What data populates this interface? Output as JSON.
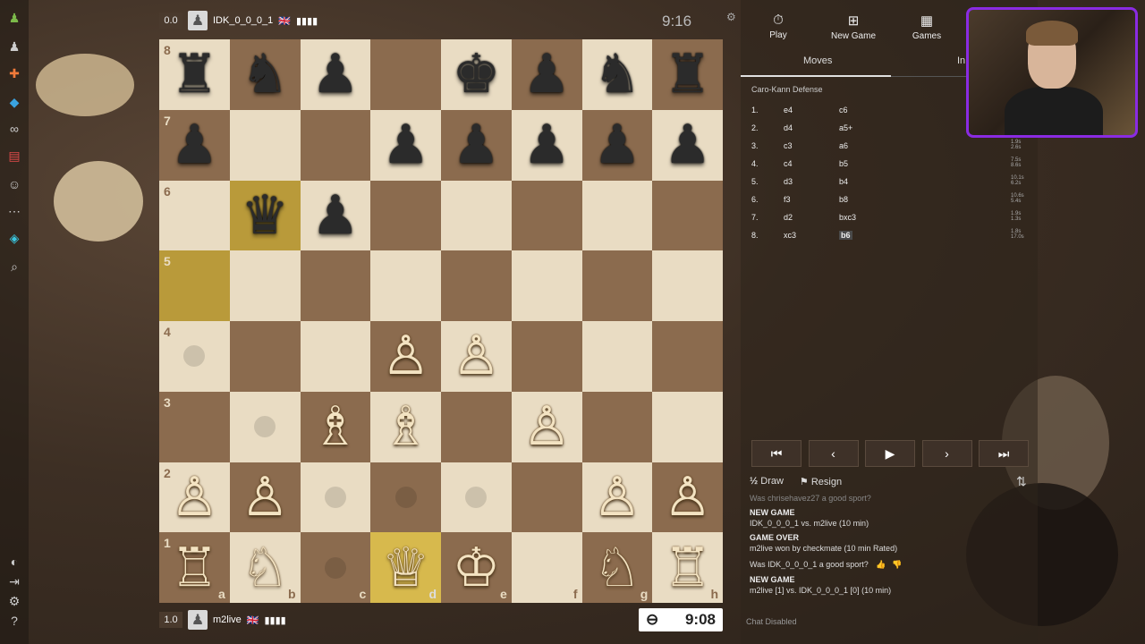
{
  "top_player": {
    "score": "0.0",
    "name": "IDK_0_0_0_1",
    "flag": "🇬🇧",
    "bars": "▮▮▮▮",
    "clock": "9:16"
  },
  "bottom_player": {
    "score": "1.0",
    "name": "m2live",
    "flag": "🇬🇧",
    "bars": "▮▮▮▮",
    "clock": "9:08",
    "clock_icon": "⊖"
  },
  "board": {
    "files": [
      "a",
      "b",
      "c",
      "d",
      "e",
      "f",
      "g",
      "h"
    ],
    "ranks": [
      "8",
      "7",
      "6",
      "5",
      "4",
      "3",
      "2",
      "1"
    ],
    "pieces": [
      {
        "sq": "a8",
        "glyph": "♜",
        "color": "b"
      },
      {
        "sq": "b8",
        "glyph": "♞",
        "color": "b"
      },
      {
        "sq": "c8",
        "glyph": "♟",
        "color": "b"
      },
      {
        "sq": "e8",
        "glyph": "♚",
        "color": "b"
      },
      {
        "sq": "f8",
        "glyph": "♟",
        "color": "b"
      },
      {
        "sq": "g8",
        "glyph": "♞",
        "color": "b"
      },
      {
        "sq": "h8",
        "glyph": "♜",
        "color": "b"
      },
      {
        "sq": "a7",
        "glyph": "♟",
        "color": "b"
      },
      {
        "sq": "d7",
        "glyph": "♟",
        "color": "b"
      },
      {
        "sq": "e7",
        "glyph": "♟",
        "color": "b"
      },
      {
        "sq": "f7",
        "glyph": "♟",
        "color": "b"
      },
      {
        "sq": "g7",
        "glyph": "♟",
        "color": "b"
      },
      {
        "sq": "h7",
        "glyph": "♟",
        "color": "b"
      },
      {
        "sq": "b6",
        "glyph": "♛",
        "color": "b"
      },
      {
        "sq": "c6",
        "glyph": "♟",
        "color": "b"
      },
      {
        "sq": "d4",
        "glyph": "♙",
        "color": "w"
      },
      {
        "sq": "e4",
        "glyph": "♙",
        "color": "w"
      },
      {
        "sq": "c3",
        "glyph": "♗",
        "color": "w"
      },
      {
        "sq": "d3",
        "glyph": "♗",
        "color": "w"
      },
      {
        "sq": "f3",
        "glyph": "♙",
        "color": "w"
      },
      {
        "sq": "a2",
        "glyph": "♙",
        "color": "w"
      },
      {
        "sq": "b2",
        "glyph": "♙",
        "color": "w"
      },
      {
        "sq": "g2",
        "glyph": "♙",
        "color": "w"
      },
      {
        "sq": "h2",
        "glyph": "♙",
        "color": "w"
      },
      {
        "sq": "a1",
        "glyph": "♖",
        "color": "w"
      },
      {
        "sq": "b1",
        "glyph": "♘",
        "color": "w"
      },
      {
        "sq": "d1",
        "glyph": "♕",
        "color": "w"
      },
      {
        "sq": "e1",
        "glyph": "♔",
        "color": "w"
      },
      {
        "sq": "g1",
        "glyph": "♘",
        "color": "w"
      },
      {
        "sq": "h1",
        "glyph": "♖",
        "color": "w"
      }
    ],
    "highlights": [
      "b6",
      "a5",
      "d1"
    ],
    "move_dots": [
      "a4",
      "b3",
      "c2",
      "d2",
      "e2",
      "c1"
    ]
  },
  "nav": {
    "play": "Play",
    "new_game": "New Game",
    "games": "Games",
    "play_icon": "⏱",
    "new_game_icon": "⊞",
    "games_icon": "▦"
  },
  "tabs": {
    "moves": "Moves",
    "info": "In"
  },
  "opening": "Caro-Kann Defense",
  "moves": [
    {
      "n": "1.",
      "w": "e4",
      "b": "c6",
      "t1": "",
      "t2": ""
    },
    {
      "n": "2.",
      "w": "d4",
      "b": "a5+",
      "t1": "",
      "t2": ""
    },
    {
      "n": "3.",
      "w": "c3",
      "b": "a6",
      "t1": "1.9s",
      "t2": "2.6s"
    },
    {
      "n": "4.",
      "w": "c4",
      "b": "b5",
      "t1": "7.5s",
      "t2": "8.6s"
    },
    {
      "n": "5.",
      "w": "d3",
      "b": "b4",
      "t1": "10.1s",
      "t2": "6.2s"
    },
    {
      "n": "6.",
      "w": "f3",
      "b": "b8",
      "t1": "10.6s",
      "t2": "5.4s"
    },
    {
      "n": "7.",
      "w": "d2",
      "b": "bxc3",
      "t1": "1.9s",
      "t2": "1.3s"
    },
    {
      "n": "8.",
      "w": "xc3",
      "b": "b6",
      "t1": "1.8s",
      "t2": "17.0s"
    }
  ],
  "controls": {
    "first": "⏮",
    "prev": "‹",
    "play": "▶",
    "next": "›",
    "last": "⏭"
  },
  "actions": {
    "draw_icon": "½",
    "draw": "Draw",
    "resign_icon": "⚑",
    "resign": "Resign",
    "flip_icon": "⇅"
  },
  "chat": {
    "cut_line": "Was chrisehavez27 a good sport?",
    "entries": [
      {
        "hd": "NEW GAME",
        "ln": "IDK_0_0_0_1 vs. m2live (10 min)"
      },
      {
        "hd": "GAME OVER",
        "ln": "m2live won by checkmate (10 min Rated)"
      },
      {
        "hd": "",
        "ln": "Was IDK_0_0_0_1 a good sport?"
      },
      {
        "hd": "NEW GAME",
        "ln": "m2live [1] vs. IDK_0_0_0_1 [0] (10 min)"
      }
    ],
    "disabled": "Chat Disabled"
  },
  "sidebar_icons": [
    "pawn-icon",
    "pawn-icon",
    "puzzle-icon",
    "cube-icon",
    "binoculars-icon",
    "news-icon",
    "friends-icon",
    "more-icon",
    "diamond-icon",
    "search-icon",
    "theme-icon",
    "logout-icon",
    "settings-icon",
    "help-icon"
  ]
}
